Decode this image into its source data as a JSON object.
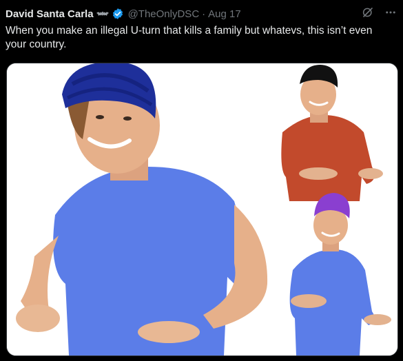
{
  "tweet": {
    "display_name": "David Santa Carla",
    "handle": "@TheOnlyDSC",
    "separator": "·",
    "date": "Aug 17",
    "text": "When you make an illegal U-turn that kills a family but whatevs, this isn’t even your country."
  },
  "icons": [
    "bat-icon",
    "verified-badge-icon",
    "grok-icon",
    "more-icon"
  ],
  "colors": {
    "background": "#000000",
    "text": "#e7e9ea",
    "muted": "#71767b",
    "verified": "#1d9bf0",
    "turban_navy": "#1e2f9a",
    "turban_black": "#111111",
    "turban_purple": "#8a3fd0",
    "shirt_blue": "#5b7de8",
    "sweater_red": "#c24a2c"
  }
}
